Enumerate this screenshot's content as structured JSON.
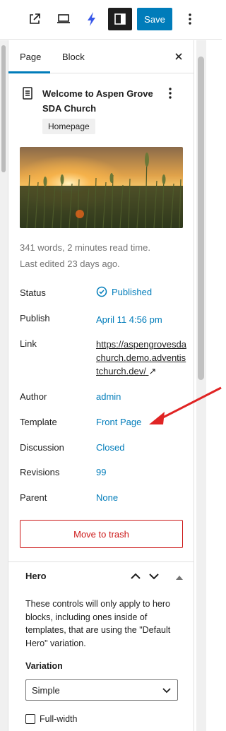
{
  "toolbar": {
    "save_label": "Save"
  },
  "tabs": [
    {
      "label": "Page"
    },
    {
      "label": "Block"
    }
  ],
  "page": {
    "title": "Welcome to Aspen Grove SDA Church",
    "badge": "Homepage",
    "stats": "341 words, 2 minutes read time.",
    "last_edited": "Last edited 23 days ago."
  },
  "summary": [
    {
      "label": "Status",
      "value": "Published"
    },
    {
      "label": "Publish",
      "value": "April 11 4:56 pm"
    },
    {
      "label": "Link",
      "value": "https://aspengrovesdachurch.demo.adventistchurch.dev/"
    },
    {
      "label": "Author",
      "value": "admin"
    },
    {
      "label": "Template",
      "value": "Front Page"
    },
    {
      "label": "Discussion",
      "value": "Closed"
    },
    {
      "label": "Revisions",
      "value": "99"
    },
    {
      "label": "Parent",
      "value": "None"
    }
  ],
  "trash_label": "Move to trash",
  "hero": {
    "title": "Hero",
    "description": "These controls will only apply to hero blocks, including ones inside of templates, that are using the \"Default Hero\" variation.",
    "variation_label": "Variation",
    "variation_value": "Simple",
    "full_width_label": "Full-width"
  },
  "colors": {
    "accent": "#007cba",
    "danger": "#cc1818",
    "annotation": "#e02424"
  }
}
